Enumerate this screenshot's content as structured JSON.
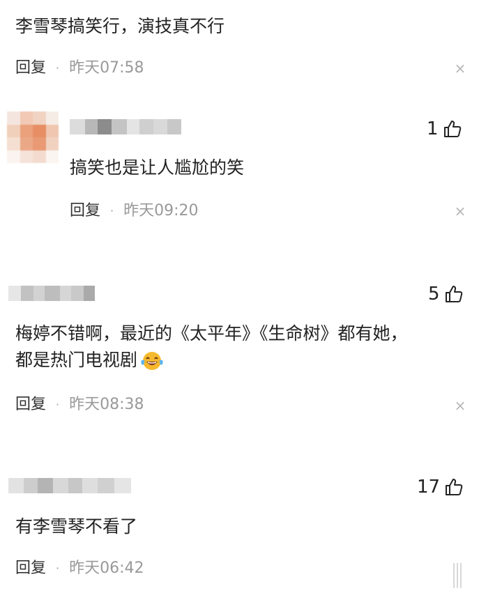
{
  "comments": [
    {
      "text": "李雪琴搞笑行，演技真不行",
      "reply_label": "回复",
      "time": "昨天07:58"
    },
    {
      "likes": "1",
      "text": "搞笑也是让人尴尬的笑",
      "reply_label": "回复",
      "time": "昨天09:20"
    },
    {
      "likes": "5",
      "text_line1": "梅婷不错啊，最近的《太平年》《生命树》都有她，",
      "text_line2": "都是热门电视剧",
      "emoji": "laughing-tears",
      "reply_label": "回复",
      "time": "昨天08:38"
    },
    {
      "likes": "17",
      "text": "有李雪琴不看了",
      "reply_label": "回复",
      "time": "昨天06:42"
    }
  ],
  "close_glyph": "×",
  "dot_glyph": "·",
  "colors": {
    "text": "#222222",
    "muted": "#999999",
    "close": "#b5b5b5",
    "emoji_face": "#f5b82e"
  }
}
